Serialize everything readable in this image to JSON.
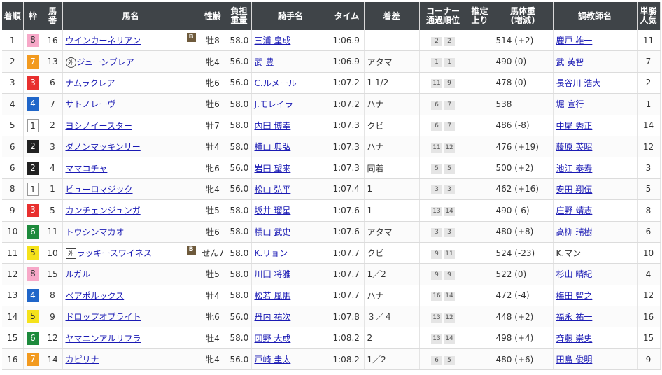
{
  "columns": [
    "着順",
    "枠",
    "馬番",
    "馬名",
    "性齢",
    "負担重量",
    "騎手名",
    "タイム",
    "着差",
    "コーナー通過順位",
    "推定上り",
    "馬体重(増減)",
    "調教師名",
    "単勝人気"
  ],
  "header": {
    "rank": "着順",
    "waku": "枠",
    "umaban_1": "馬",
    "umaban_2": "番",
    "horse": "馬名",
    "sexage": "性齢",
    "weight_1": "負担",
    "weight_2": "重量",
    "jockey": "騎手名",
    "time": "タイム",
    "margin": "着差",
    "corner_1": "コーナー",
    "corner_2": "通過順位",
    "agari_1": "推定",
    "agari_2": "上り",
    "body_1": "馬体重",
    "body_2": "(増減)",
    "trainer": "調教師名",
    "pop_1": "単勝",
    "pop_2": "人気"
  },
  "rows": [
    {
      "rank": "1",
      "waku": "8",
      "umaban": "16",
      "mark": "",
      "blinker": "B",
      "horse": "ウインカーネリアン",
      "sexage": "牡8",
      "weight": "58.0",
      "jockey": "三浦 皇成",
      "time": "1:06.9",
      "margin": "",
      "corner": [
        "2",
        "2"
      ],
      "agari": "",
      "body": "514 (+2)",
      "trainer": "鹿戸 雄一",
      "trainer_link": true,
      "pop": "11"
    },
    {
      "rank": "2",
      "waku": "7",
      "umaban": "13",
      "mark": "外",
      "mark_shape": "circle",
      "blinker": "",
      "horse": "ジューンブレア",
      "sexage": "牝4",
      "weight": "56.0",
      "jockey": "武 豊",
      "time": "1:06.9",
      "margin": "アタマ",
      "corner": [
        "1",
        "1"
      ],
      "agari": "",
      "body": "490 (0)",
      "trainer": "武 英智",
      "trainer_link": true,
      "pop": "7"
    },
    {
      "rank": "3",
      "waku": "3",
      "umaban": "6",
      "mark": "",
      "blinker": "",
      "horse": "ナムラクレア",
      "sexage": "牝6",
      "weight": "56.0",
      "jockey": "C.ルメール",
      "time": "1:07.2",
      "margin": "1 1/2",
      "corner": [
        "11",
        "9"
      ],
      "agari": "",
      "body": "478 (0)",
      "trainer": "長谷川 浩大",
      "trainer_link": true,
      "pop": "2"
    },
    {
      "rank": "4",
      "waku": "4",
      "umaban": "7",
      "mark": "",
      "blinker": "",
      "horse": "サトノレーヴ",
      "sexage": "牡6",
      "weight": "58.0",
      "jockey": "J.モレイラ",
      "time": "1:07.2",
      "margin": "ハナ",
      "corner": [
        "6",
        "7"
      ],
      "agari": "",
      "body": "538",
      "trainer": "堀 宣行",
      "trainer_link": true,
      "pop": "1"
    },
    {
      "rank": "5",
      "waku": "1",
      "umaban": "2",
      "mark": "",
      "blinker": "",
      "horse": "ヨシノイースター",
      "sexage": "牡7",
      "weight": "58.0",
      "jockey": "内田 博幸",
      "time": "1:07.3",
      "margin": "クビ",
      "corner": [
        "6",
        "7"
      ],
      "agari": "",
      "body": "486 (-8)",
      "trainer": "中尾 秀正",
      "trainer_link": true,
      "pop": "14"
    },
    {
      "rank": "6",
      "waku": "2",
      "umaban": "3",
      "mark": "",
      "blinker": "",
      "horse": "ダノンマッキンリー",
      "sexage": "牡4",
      "weight": "58.0",
      "jockey": "横山 典弘",
      "time": "1:07.3",
      "margin": "ハナ",
      "corner": [
        "11",
        "12"
      ],
      "agari": "",
      "body": "476 (+19)",
      "trainer": "藤原 英昭",
      "trainer_link": true,
      "pop": "12"
    },
    {
      "rank": "6",
      "waku": "2",
      "umaban": "4",
      "mark": "",
      "blinker": "",
      "horse": "ママコチャ",
      "sexage": "牝6",
      "weight": "56.0",
      "jockey": "岩田 望来",
      "time": "1:07.3",
      "margin": "同着",
      "corner": [
        "5",
        "5"
      ],
      "agari": "",
      "body": "500 (+2)",
      "trainer": "池江 泰寿",
      "trainer_link": true,
      "pop": "3"
    },
    {
      "rank": "8",
      "waku": "1",
      "umaban": "1",
      "mark": "",
      "blinker": "",
      "horse": "ピューロマジック",
      "sexage": "牝4",
      "weight": "56.0",
      "jockey": "松山 弘平",
      "time": "1:07.4",
      "margin": "1",
      "corner": [
        "3",
        "3"
      ],
      "agari": "",
      "body": "462 (+16)",
      "trainer": "安田 翔伍",
      "trainer_link": true,
      "pop": "5"
    },
    {
      "rank": "9",
      "waku": "3",
      "umaban": "5",
      "mark": "",
      "blinker": "",
      "horse": "カンチェンジュンガ",
      "sexage": "牡5",
      "weight": "58.0",
      "jockey": "坂井 瑠星",
      "time": "1:07.6",
      "margin": "1",
      "corner": [
        "13",
        "14"
      ],
      "agari": "",
      "body": "490 (-6)",
      "trainer": "庄野 靖志",
      "trainer_link": true,
      "pop": "8"
    },
    {
      "rank": "10",
      "waku": "6",
      "umaban": "11",
      "mark": "",
      "blinker": "",
      "horse": "トウシンマカオ",
      "sexage": "牡6",
      "weight": "58.0",
      "jockey": "横山 武史",
      "time": "1:07.6",
      "margin": "アタマ",
      "corner": [
        "3",
        "3"
      ],
      "agari": "",
      "body": "480 (+8)",
      "trainer": "高柳 瑞樹",
      "trainer_link": true,
      "pop": "6"
    },
    {
      "rank": "11",
      "waku": "5",
      "umaban": "10",
      "mark": "外",
      "mark_shape": "square",
      "blinker": "B",
      "horse": "ラッキースワイネス",
      "sexage": "せん7",
      "weight": "58.0",
      "jockey": "K.リョン",
      "time": "1:07.7",
      "margin": "クビ",
      "corner": [
        "9",
        "11"
      ],
      "agari": "",
      "body": "524 (-23)",
      "trainer": "K.マン",
      "trainer_link": false,
      "pop": "10"
    },
    {
      "rank": "12",
      "waku": "8",
      "umaban": "15",
      "mark": "",
      "blinker": "",
      "horse": "ルガル",
      "sexage": "牡5",
      "weight": "58.0",
      "jockey": "川田 将雅",
      "time": "1:07.7",
      "margin": "1／2",
      "corner": [
        "9",
        "9"
      ],
      "agari": "",
      "body": "522 (0)",
      "trainer": "杉山 晴紀",
      "trainer_link": true,
      "pop": "4"
    },
    {
      "rank": "13",
      "waku": "4",
      "umaban": "8",
      "mark": "",
      "blinker": "",
      "horse": "ベアポルックス",
      "sexage": "牡4",
      "weight": "58.0",
      "jockey": "松若 風馬",
      "time": "1:07.7",
      "margin": "ハナ",
      "corner": [
        "16",
        "14"
      ],
      "agari": "",
      "body": "472 (-4)",
      "trainer": "梅田 智之",
      "trainer_link": true,
      "pop": "12"
    },
    {
      "rank": "14",
      "waku": "5",
      "umaban": "9",
      "mark": "",
      "blinker": "",
      "horse": "ドロップオブライト",
      "sexage": "牝6",
      "weight": "56.0",
      "jockey": "丹内 祐次",
      "time": "1:07.8",
      "margin": "３／４",
      "corner": [
        "13",
        "12"
      ],
      "agari": "",
      "body": "448 (+2)",
      "trainer": "福永 祐一",
      "trainer_link": true,
      "pop": "16"
    },
    {
      "rank": "15",
      "waku": "6",
      "umaban": "12",
      "mark": "",
      "blinker": "",
      "horse": "ヤマニンアルリフラ",
      "sexage": "牡4",
      "weight": "58.0",
      "jockey": "団野 大成",
      "time": "1:08.2",
      "margin": "2",
      "corner": [
        "13",
        "14"
      ],
      "agari": "",
      "body": "498 (+4)",
      "trainer": "斉藤 崇史",
      "trainer_link": true,
      "pop": "15"
    },
    {
      "rank": "16",
      "waku": "7",
      "umaban": "14",
      "mark": "",
      "blinker": "",
      "horse": "カピリナ",
      "sexage": "牝4",
      "weight": "56.0",
      "jockey": "戸崎 圭太",
      "time": "1:08.2",
      "margin": "1／2",
      "corner": [
        "6",
        "5"
      ],
      "agari": "",
      "body": "480 (+6)",
      "trainer": "田島 俊明",
      "trainer_link": true,
      "pop": "9"
    }
  ]
}
